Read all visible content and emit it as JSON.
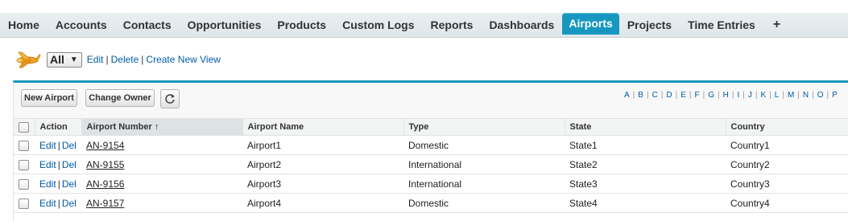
{
  "tabs": [
    {
      "label": "Home"
    },
    {
      "label": "Accounts"
    },
    {
      "label": "Contacts"
    },
    {
      "label": "Opportunities"
    },
    {
      "label": "Products"
    },
    {
      "label": "Custom Logs"
    },
    {
      "label": "Reports"
    },
    {
      "label": "Dashboards"
    },
    {
      "label": "Airports",
      "active": true
    },
    {
      "label": "Projects"
    },
    {
      "label": "Time Entries"
    },
    {
      "label": "+"
    }
  ],
  "view": {
    "icon": "airplane-icon",
    "selected": "All",
    "links": [
      "Edit",
      "Delete",
      "Create New View"
    ]
  },
  "toolbar": {
    "new_label": "New Airport",
    "owner_label": "Change Owner",
    "refresh_icon": "refresh-icon"
  },
  "alphabet": [
    "A",
    "B",
    "C",
    "D",
    "E",
    "F",
    "G",
    "H",
    "I",
    "J",
    "K",
    "L",
    "M",
    "N",
    "O",
    "P"
  ],
  "table": {
    "columns": [
      "Action",
      "Airport Number",
      "Airport Name",
      "Type",
      "State",
      "Country"
    ],
    "sort_indicator": "↑",
    "action_edit": "Edit",
    "action_del": "Del",
    "rows": [
      {
        "number": "AN-9154",
        "name": "Airport1",
        "type": "Domestic",
        "state": "State1",
        "country": "Country1"
      },
      {
        "number": "AN-9155",
        "name": "Airport2",
        "type": "International",
        "state": "State2",
        "country": "Country2"
      },
      {
        "number": "AN-9156",
        "name": "Airport3",
        "type": "International",
        "state": "State3",
        "country": "Country3"
      },
      {
        "number": "AN-9157",
        "name": "Airport4",
        "type": "Domestic",
        "state": "State4",
        "country": "Country4"
      }
    ]
  },
  "colors": {
    "accent": "#1797c0",
    "link": "#015ba7"
  }
}
